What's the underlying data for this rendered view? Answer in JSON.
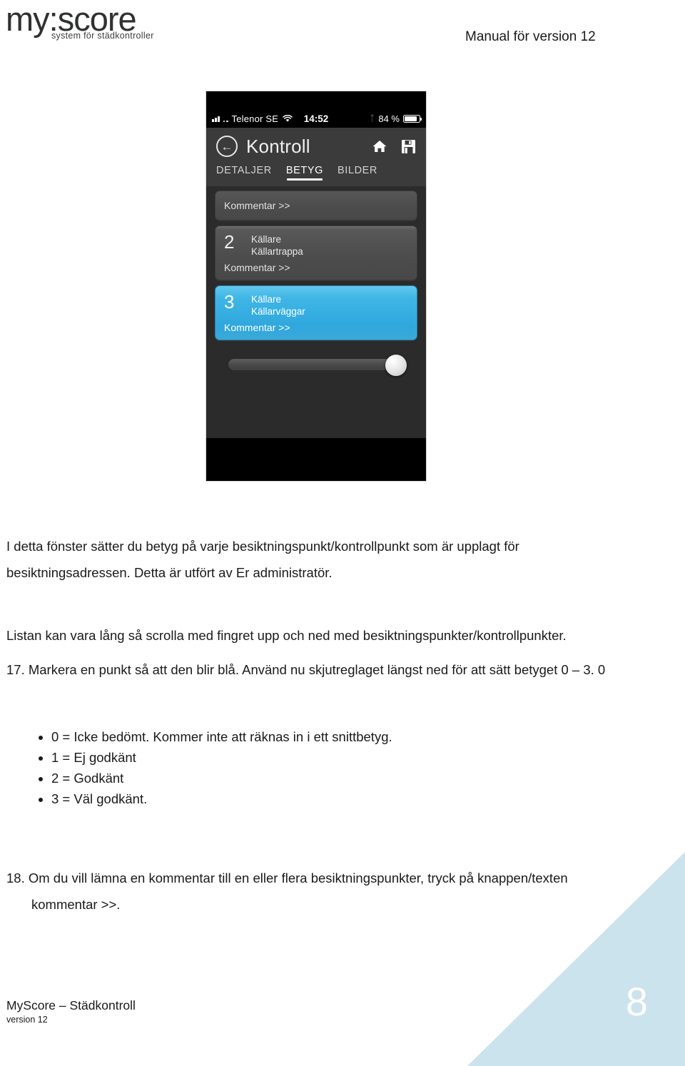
{
  "header": {
    "logo_main": "my:score",
    "logo_sub": "system för städkontroller",
    "manual_title": "Manual för version 12"
  },
  "phone": {
    "statusbar": {
      "carrier": "Telenor SE",
      "time": "14:52",
      "battery_percent": "84 %",
      "signal_icon": "signal-bars-icon",
      "wifi_icon": "wifi-icon",
      "bluetooth_icon": "bluetooth-icon",
      "battery_icon": "battery-icon"
    },
    "navbar": {
      "back_icon": "back-arrow-icon",
      "title": "Kontroll",
      "home_icon": "home-icon",
      "save_icon": "save-floppy-icon"
    },
    "tabs": [
      {
        "label": "DETALJER",
        "active": false
      },
      {
        "label": "BETYG",
        "active": true
      },
      {
        "label": "BILDER",
        "active": false
      }
    ],
    "cards": [
      {
        "partial": true,
        "score": "",
        "line1": "",
        "line2": "",
        "comment": "Kommentar >>",
        "selected": false
      },
      {
        "partial": false,
        "score": "2",
        "line1": "Källare",
        "line2": "Källartrappa",
        "comment": "Kommentar >>",
        "selected": false
      },
      {
        "partial": false,
        "score": "3",
        "line1": "Källare",
        "line2": "Källarväggar",
        "comment": "Kommentar >>",
        "selected": true
      }
    ],
    "slider": {
      "name": "betyg-slider",
      "value_position": "max"
    },
    "colors": {
      "selected_card": "#3fb6e6",
      "card_grey": "#4c4c4c",
      "screen_bg": "#2b2b2b",
      "navbar": "#3b3b3b"
    }
  },
  "body": {
    "p1": "I detta fönster sätter du betyg på varje besiktningspunkt/kontrollpunkt som är upplagt för besiktningsadressen. Detta är utfört av Er administratör.",
    "p2": "Listan kan vara lång så scrolla med fingret upp och ned med besiktningspunkter/kontrollpunkter.",
    "p3": "17. Markera en punkt så att den blir blå. Använd nu skjutreglaget längst ned för att sätt betyget 0 – 3. 0",
    "bullets": [
      "0 = Icke bedömt. Kommer inte att räknas in i ett snittbetyg.",
      "1 = Ej godkänt",
      "2 = Godkänt",
      "3 = Väl godkänt."
    ],
    "p4_line1": "18. Om du vill lämna en kommentar till en eller flera besiktningspunkter, tryck på knappen/texten",
    "p4_line2": "kommentar >>."
  },
  "footer": {
    "main": "MyScore – Städkontroll",
    "sub": "version 12",
    "page_number": "8",
    "accent_color": "#cbe3ec"
  }
}
